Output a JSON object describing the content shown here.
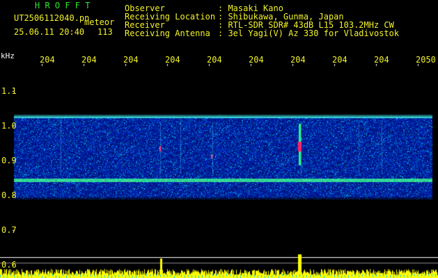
{
  "header": {
    "app_name": "H R O F F T",
    "filename": "UT2506112040.pn",
    "meteor_label": "meteor",
    "datetime": "25.06.11 20:40",
    "count": "113",
    "info_labels": [
      "Observer",
      "Receiving Location",
      "Receiver",
      "Receiving Antenna"
    ],
    "info_values": [
      ": Masaki Kano",
      ": Shibukawa, Gunma, Japan",
      ": RTL-SDR SDR# 43dB L15 103.2MHz CW",
      ": 3el Yagi(V) Az 330 for Vladivostok"
    ]
  },
  "axis": {
    "unit": "kHz",
    "time_ticks": [
      "204",
      "204",
      "204",
      "204",
      "204",
      "204",
      "204",
      "204",
      "204",
      "2050"
    ],
    "freq_ticks": [
      "1.1",
      "1.0",
      "0.9",
      "0.8",
      "0.7",
      "0.6"
    ]
  },
  "colors": {
    "header_text": "#f2f22a",
    "app_name": "#2ee62e",
    "background": "#000000",
    "spectrum_base": "#0a1a9e",
    "meteor_echo": "#ff2266",
    "amplitude_bars": "#ffff00"
  }
}
